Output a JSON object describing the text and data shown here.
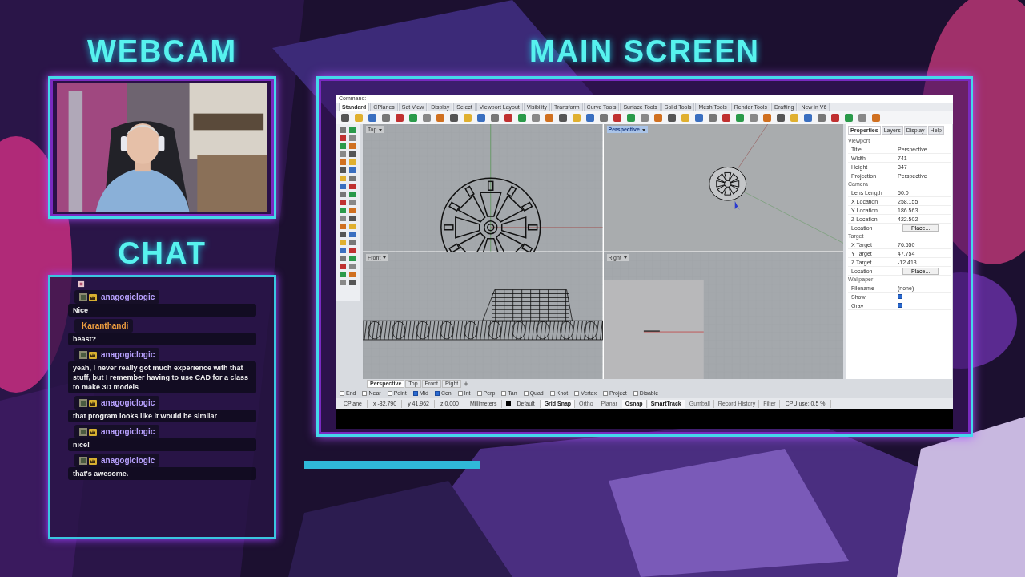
{
  "overlay": {
    "webcam_title": "WEBCAM",
    "chat_title": "CHAT",
    "main_title": "MAIN SCREEN"
  },
  "chat": {
    "messages": [
      {
        "user": "anagogiclogic",
        "color": "#b9a2ff",
        "badges": true,
        "text": "Nice"
      },
      {
        "user": "Karanthandi",
        "color": "#f0a040",
        "badges": false,
        "text": "beast?"
      },
      {
        "user": "anagogiclogic",
        "color": "#b9a2ff",
        "badges": true,
        "text": "yeah, I never really got much experience with that stuff, but I remember having to use CAD for a class to make 3D models"
      },
      {
        "user": "anagogiclogic",
        "color": "#b9a2ff",
        "badges": true,
        "text": "that program looks like it would be similar"
      },
      {
        "user": "anagogiclogic",
        "color": "#b9a2ff",
        "badges": true,
        "text": "nice!"
      },
      {
        "user": "anagogiclogic",
        "color": "#b9a2ff",
        "badges": true,
        "text": "that's awesome."
      }
    ]
  },
  "app": {
    "command": "Command:",
    "toolbar_tabs": [
      {
        "label": "Standard",
        "selected": true
      },
      {
        "label": "CPlanes",
        "selected": false
      },
      {
        "label": "Set View",
        "selected": false
      },
      {
        "label": "Display",
        "selected": false
      },
      {
        "label": "Select",
        "selected": false
      },
      {
        "label": "Viewport Layout",
        "selected": false
      },
      {
        "label": "Visibility",
        "selected": false
      },
      {
        "label": "Transform",
        "selected": false
      },
      {
        "label": "Curve Tools",
        "selected": false
      },
      {
        "label": "Surface Tools",
        "selected": false
      },
      {
        "label": "Solid Tools",
        "selected": false
      },
      {
        "label": "Mesh Tools",
        "selected": false
      },
      {
        "label": "Render Tools",
        "selected": false
      },
      {
        "label": "Drafting",
        "selected": false
      },
      {
        "label": "New in V6",
        "selected": false
      }
    ],
    "viewports": [
      {
        "label": "Top",
        "kind": "top",
        "selected": false
      },
      {
        "label": "Perspective",
        "kind": "perspective",
        "selected": true
      },
      {
        "label": "Front",
        "kind": "front",
        "selected": false
      },
      {
        "label": "Right",
        "kind": "right",
        "selected": false
      }
    ],
    "properties_tabs": [
      {
        "label": "Properties",
        "selected": true
      },
      {
        "label": "Layers",
        "selected": false
      },
      {
        "label": "Display",
        "selected": false
      },
      {
        "label": "Help",
        "selected": false
      }
    ],
    "properties": [
      {
        "title": "Viewport",
        "rows": [
          {
            "label": "Title",
            "kind": "text",
            "value": "Perspective"
          },
          {
            "label": "Width",
            "kind": "text",
            "value": "741"
          },
          {
            "label": "Height",
            "kind": "text",
            "value": "347"
          },
          {
            "label": "Projection",
            "kind": "text",
            "value": "Perspective"
          }
        ]
      },
      {
        "title": "Camera",
        "rows": [
          {
            "label": "Lens Length",
            "kind": "text",
            "value": "50.0"
          },
          {
            "label": "X Location",
            "kind": "text",
            "value": "258.155"
          },
          {
            "label": "Y Location",
            "kind": "text",
            "value": "186.563"
          },
          {
            "label": "Z Location",
            "kind": "text",
            "value": "422.502"
          },
          {
            "label": "Location",
            "kind": "button",
            "value": "Place..."
          }
        ]
      },
      {
        "title": "Target",
        "rows": [
          {
            "label": "X Target",
            "kind": "text",
            "value": "76.550"
          },
          {
            "label": "Y Target",
            "kind": "text",
            "value": "47.754"
          },
          {
            "label": "Z Target",
            "kind": "text",
            "value": "-12.413"
          },
          {
            "label": "Location",
            "kind": "button",
            "value": "Place..."
          }
        ]
      },
      {
        "title": "Wallpaper",
        "rows": [
          {
            "label": "Filename",
            "kind": "text",
            "value": "(none)"
          },
          {
            "label": "Show",
            "kind": "checkbox",
            "checked": true
          },
          {
            "label": "Gray",
            "kind": "checkbox",
            "checked": true
          }
        ]
      }
    ],
    "viewport_tabs": [
      {
        "label": "Perspective",
        "selected": true
      },
      {
        "label": "Top",
        "selected": false
      },
      {
        "label": "Front",
        "selected": false
      },
      {
        "label": "Right",
        "selected": false
      }
    ],
    "osnaps": [
      {
        "label": "End",
        "checked": false
      },
      {
        "label": "Near",
        "checked": false
      },
      {
        "label": "Point",
        "checked": false
      },
      {
        "label": "Mid",
        "checked": true
      },
      {
        "label": "Cen",
        "checked": true
      },
      {
        "label": "Int",
        "checked": false
      },
      {
        "label": "Perp",
        "checked": false
      },
      {
        "label": "Tan",
        "checked": false
      },
      {
        "label": "Quad",
        "checked": false
      },
      {
        "label": "Knot",
        "checked": false
      },
      {
        "label": "Vertex",
        "checked": false
      },
      {
        "label": "Project",
        "checked": false
      },
      {
        "label": "Disable",
        "checked": false
      }
    ],
    "status": {
      "coords": [
        "CPlane",
        "x -82.790",
        "y 41.962",
        "z 0.000"
      ],
      "units": "Millimeters",
      "layer": "Default",
      "toggles": [
        {
          "label": "Grid Snap",
          "on": true
        },
        {
          "label": "Ortho",
          "on": false
        },
        {
          "label": "Planar",
          "on": false
        },
        {
          "label": "Osnap",
          "on": true
        },
        {
          "label": "SmartTrack",
          "on": true
        },
        {
          "label": "Gumball",
          "on": false
        },
        {
          "label": "Record History",
          "on": false
        },
        {
          "label": "Filter",
          "on": false
        }
      ],
      "cpu": "CPU use: 0.5 %"
    }
  }
}
